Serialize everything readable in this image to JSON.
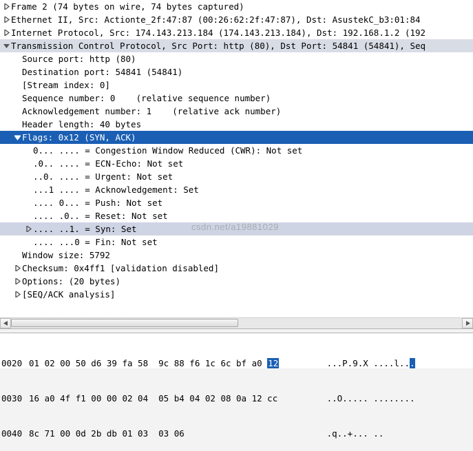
{
  "tree": {
    "frame": "Frame 2 (74 bytes on wire, 74 bytes captured)",
    "eth": "Ethernet II, Src: Actionte_2f:47:87 (00:26:62:2f:47:87), Dst: AsustekC_b3:01:84",
    "ip": "Internet Protocol, Src: 174.143.213.184 (174.143.213.184), Dst: 192.168.1.2 (192",
    "tcp": "Transmission Control Protocol, Src Port: http (80), Dst Port: 54841 (54841), Seq",
    "src_port": "Source port: http (80)",
    "dst_port": "Destination port: 54841 (54841)",
    "stream": "[Stream index: 0]",
    "seq": "Sequence number: 0    (relative sequence number)",
    "ack": "Acknowledgement number: 1    (relative ack number)",
    "hdr_len": "Header length: 40 bytes",
    "flags": "Flags: 0x12 (SYN, ACK)",
    "cwr": "0... .... = Congestion Window Reduced (CWR): Not set",
    "ece": ".0.. .... = ECN-Echo: Not set",
    "urg": "..0. .... = Urgent: Not set",
    "ackf": "...1 .... = Acknowledgement: Set",
    "psh": ".... 0... = Push: Not set",
    "rst": ".... .0.. = Reset: Not set",
    "syn": ".... ..1. = Syn: Set",
    "fin": ".... ...0 = Fin: Not set",
    "win": "Window size: 5792",
    "cksum": "Checksum: 0x4ff1 [validation disabled]",
    "opts": "Options: (20 bytes)",
    "seqack": "[SEQ/ACK analysis]"
  },
  "hex": {
    "rows": [
      {
        "off": "0020",
        "bytes_pre": "01 02 00 50 d6 39 fa 58  9c 88 f6 1c 6c bf a0 ",
        "bytes_hl": "12",
        "bytes_post": "",
        "ascii_pre": "   ...P.9.X ....l..",
        "ascii_hl": ".",
        "ascii_post": ""
      },
      {
        "off": "0030",
        "bytes_pre": "16 a0 4f f1 00 00 02 04  05 b4 04 02 08 0a 12 cc",
        "bytes_hl": "",
        "bytes_post": "",
        "ascii_pre": "   ..O..... ........",
        "ascii_hl": "",
        "ascii_post": ""
      },
      {
        "off": "0040",
        "bytes_pre": "8c 71 00 0d 2b db 01 03  03 06",
        "bytes_hl": "",
        "bytes_post": "",
        "ascii_pre": "   .q..+... ..",
        "ascii_hl": "",
        "ascii_post": ""
      }
    ]
  },
  "watermark": "csdn.net/a19881029"
}
